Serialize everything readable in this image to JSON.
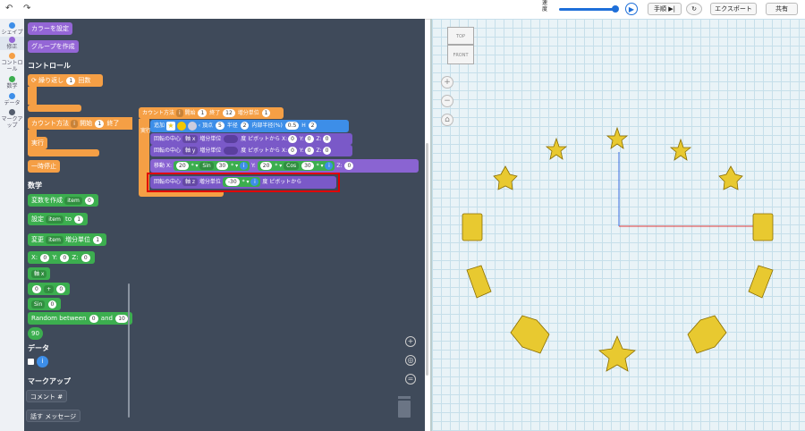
{
  "toolbar": {
    "undo": "↶",
    "redo": "↷",
    "speed_label": "速度",
    "speed_value": 1.0,
    "play_icon": "play-icon",
    "step_label": "手順",
    "step_icon": "step-icon",
    "reset_icon": "reset-icon",
    "export_label": "エクスポート",
    "share_label": "共有",
    "accent_color": "#1e6fd9"
  },
  "rail": {
    "items": [
      {
        "label": "シェイプ",
        "color": "#3d8ee8"
      },
      {
        "label": "修正",
        "color": "#9466d6"
      },
      {
        "label": "コントロール",
        "color": "#f59f45"
      },
      {
        "label": "数学",
        "color": "#3cae4f"
      },
      {
        "label": "データ",
        "color": "#3d8ee8"
      },
      {
        "label": "マークアップ",
        "color": "#555e6e"
      }
    ]
  },
  "palette": {
    "set_color": "カラーを設定",
    "create_group": "グループを作成",
    "control_heading": "コントロール",
    "repeat_label": "繰り返し",
    "repeat_count": "1",
    "repeat_unit": "回数",
    "count_label": "カウント方法",
    "count_var": "i",
    "count_start_label": "開始",
    "count_start": "1",
    "count_end_label": "終了",
    "do_label": "実行",
    "pause_label": "一時停止",
    "math_heading": "数学",
    "create_var_label": "変数を作成",
    "create_var_name": "item",
    "create_var_value": "0",
    "set_label": "設定",
    "set_var": "item",
    "set_to": "to",
    "set_value": "1",
    "change_label": "変更",
    "change_var": "item",
    "change_step_label": "増分単位",
    "change_value": "1",
    "xyz_x": "0",
    "xyz_y": "0",
    "xyz_z": "0",
    "axis_label": "軸 x",
    "op_left": "0",
    "op": "+",
    "op_right": "0",
    "sin_label": "Sin",
    "sin_value": "0",
    "random_label": "Random between",
    "random_from": "0",
    "random_and": "and",
    "random_to": "10",
    "ninety": "90",
    "data_heading": "データ",
    "data_var": "i",
    "markup_heading": "マークアップ",
    "comment_label": "コメント #",
    "say_label": "話す",
    "say_value": "メッセージ"
  },
  "workspace": {
    "count_label": "カウント方法",
    "count_var": "i",
    "start_label": "開始",
    "start": "1",
    "end_label": "終了",
    "end": "12",
    "step_label": "増分単位",
    "step": "1",
    "do_label": "実行",
    "add_label": "追加",
    "star_points_label": "頂点",
    "star_points": "5",
    "radius_label": "半径",
    "radius": "2",
    "inner_label": "内部半径(%)",
    "inner": "0.5",
    "height_label": "H",
    "height": "2",
    "rot1_label": "回転の中心",
    "rot1_axis": "軸 x",
    "rot1_step_label": "増分単位",
    "rot1_value": "",
    "rot1_deg": "度 ピボットから",
    "rot1_x": "0",
    "rot1_y": "0",
    "rot1_z": "0",
    "rot2_label": "回転の中心",
    "rot2_axis": "軸 y",
    "rot2_step_label": "増分単位",
    "rot2_value": "",
    "rot2_deg": "度 ピボットから",
    "rot2_x": "0",
    "rot2_y": "0",
    "rot2_z": "0",
    "move_label": "移動",
    "move_x_label": "X:",
    "move_x": "20",
    "move_mult": "* ▾",
    "sin_label": "Sin",
    "sin_arg": "30",
    "move_y_label": "Y:",
    "move_y": "20",
    "cos_label": "Cos",
    "cos_arg": "30",
    "var_i": "i",
    "move_z_label": "Z:",
    "move_z": "0",
    "rot3_label": "回転の中心",
    "rot3_axis": "軸 z",
    "rot3_step_label": "増分単位",
    "rot3_value": "-30",
    "rot3_mult": "* ▾",
    "rot3_var": "i",
    "rot3_deg": "度",
    "rot3_pivot": "ピボットから",
    "zoom_in_icon": "zoom-in-icon",
    "zoom_reset_icon": "target-icon",
    "zoom_out_icon": "equals-icon",
    "highlight_color": "#e00000"
  },
  "viewer": {
    "cube_top": "TOP",
    "cube_front": "FRONT",
    "star_color": "#e8c930",
    "axis_x_color": "#e03a3a",
    "axis_y_color": "#3a6ee0"
  }
}
